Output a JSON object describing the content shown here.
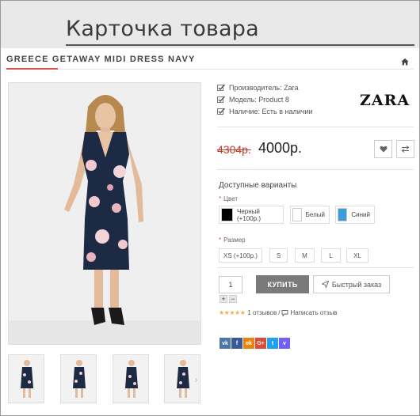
{
  "banner": {
    "title": "Карточка товара"
  },
  "product": {
    "title": "GREECE GETAWAY MIDI DRESS NAVY"
  },
  "info": {
    "manufacturer": "Производитель: Zara",
    "model": "Модель: Product 8",
    "availability": "Наличие: Есть в наличии"
  },
  "brand": {
    "logo_text": "ZARA"
  },
  "price": {
    "old": "4304р.",
    "new": "4000р."
  },
  "options": {
    "title": "Доступные варианты",
    "color_label": "Цвет",
    "colors": [
      {
        "label": "Черный (+100р.)",
        "hex": "#000000"
      },
      {
        "label": "Белый",
        "hex": "#ffffff"
      },
      {
        "label": "Синий",
        "hex": "#3a9fd6"
      }
    ],
    "size_label": "Размер",
    "sizes": [
      "XS (+100р.)",
      "S",
      "M",
      "L",
      "XL"
    ]
  },
  "purchase": {
    "quantity": "1",
    "plus": "+",
    "minus": "−",
    "buy_label": "КУПИТЬ",
    "quick_label": "Быстрый заказ"
  },
  "reviews": {
    "stars": "★★★★★",
    "count_text": "1 отзывов",
    "separator": "/",
    "write_text": "Написать отзыв"
  },
  "social": [
    "vk",
    "f",
    "ok",
    "G+",
    "t",
    "v"
  ],
  "colors": {
    "accent": "#d9534f",
    "button": "#7a7a7a",
    "star": "#f0ad4e",
    "dress": "#1d2a44",
    "vk": "#4a76a8",
    "facebook": "#3b5998",
    "odnoklassniki": "#ee8208",
    "googleplus": "#dd4b39",
    "twitter": "#1da1f2",
    "viber": "#7360f2"
  }
}
